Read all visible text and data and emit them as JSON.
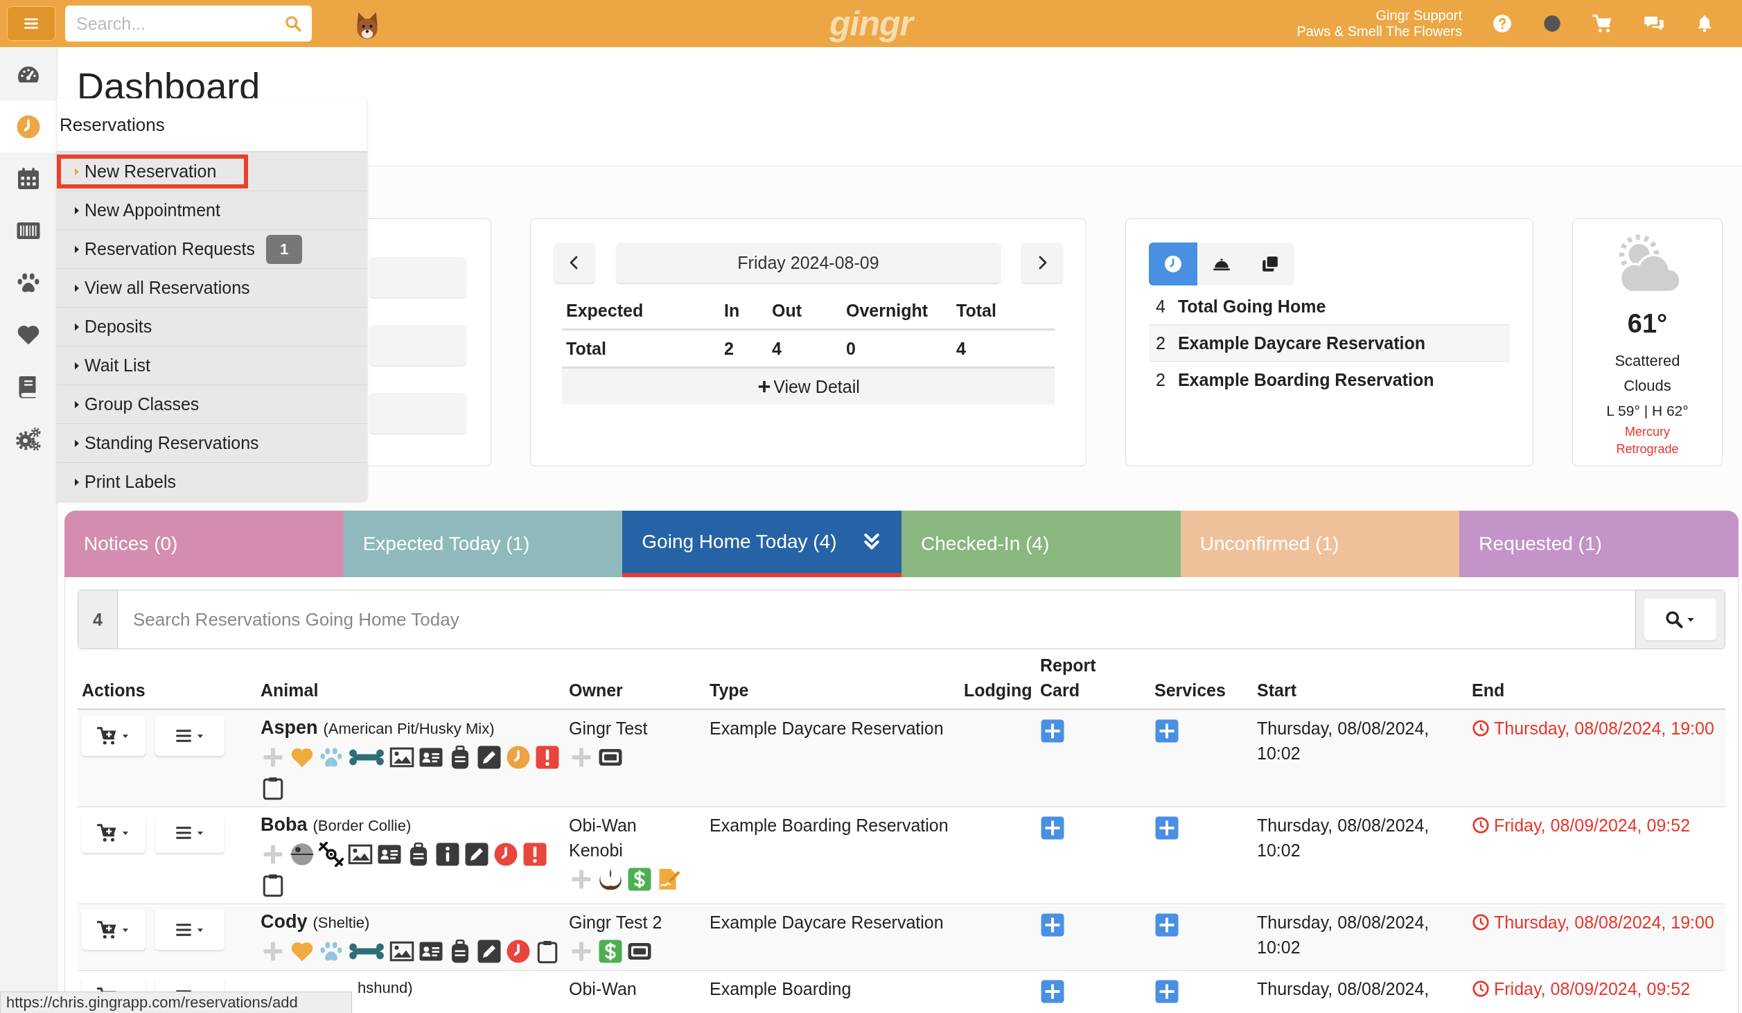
{
  "top_bar": {
    "search": {
      "placeholder": "Search..."
    },
    "logo": "gingr",
    "user": {
      "name": "Gingr Support",
      "business": "Paws & Smell The Flowers"
    }
  },
  "sidebar": {
    "items": [
      {
        "kind": "gauge",
        "selected": false
      },
      {
        "kind": "clock",
        "selected": true
      },
      {
        "kind": "calendar",
        "selected": false
      },
      {
        "kind": "barcode",
        "selected": false
      },
      {
        "kind": "paw",
        "selected": false
      },
      {
        "kind": "heart",
        "selected": false
      },
      {
        "kind": "book",
        "selected": false
      },
      {
        "kind": "gears",
        "selected": false
      }
    ]
  },
  "page_title": "Dashboard",
  "reservations_menu": {
    "title": "Reservations",
    "items": [
      {
        "label": "New Reservation",
        "selected": true
      },
      {
        "label": "New Appointment",
        "selected": false
      },
      {
        "label": "Reservation Requests",
        "selected": false,
        "badge": "1"
      },
      {
        "label": "View all Reservations",
        "selected": false
      },
      {
        "label": "Deposits",
        "selected": false
      },
      {
        "label": "Wait List",
        "selected": false
      },
      {
        "label": "Group Classes",
        "selected": false
      },
      {
        "label": "Standing Reservations",
        "selected": false
      },
      {
        "label": "Print Labels",
        "selected": false
      }
    ]
  },
  "date_card": {
    "date": "Friday 2024-08-09",
    "columns": [
      "Expected",
      "In",
      "Out",
      "Overnight",
      "Total"
    ],
    "row": [
      "Total",
      "2",
      "4",
      "0",
      "4"
    ],
    "link": "View Detail"
  },
  "summary_card": {
    "toggles": [
      {
        "kind": "clock",
        "selected": true
      },
      {
        "kind": "service-bell",
        "selected": false
      },
      {
        "kind": "copy",
        "selected": false
      }
    ],
    "rows": [
      {
        "count": "4",
        "label": "Total Going Home"
      },
      {
        "count": "2",
        "label": "Example Daycare Reservation"
      },
      {
        "count": "2",
        "label": "Example Boarding Reservation"
      }
    ]
  },
  "weather": {
    "temperature": "61°",
    "condition": "Scattered Clouds",
    "range": "L 59° | H 62°",
    "note": "Mercury Retrograde"
  },
  "tabs": [
    {
      "label": "Notices (0)",
      "color": "#d48db1",
      "selected": false
    },
    {
      "label": "Expected Today (1)",
      "color": "#8fb9bc",
      "selected": false
    },
    {
      "label": "Going Home Today (4)",
      "color": "#2563a6",
      "selected": true
    },
    {
      "label": "Checked-In (4)",
      "color": "#89b77f",
      "selected": false
    },
    {
      "label": "Unconfirmed (1)",
      "color": "#efc19b",
      "selected": false
    },
    {
      "label": "Requested (1)",
      "color": "#c493c8",
      "selected": false
    }
  ],
  "reservations": {
    "count": "4",
    "search": {
      "placeholder": "Search Reservations Going Home Today"
    },
    "columns": [
      "Actions",
      "Animal",
      "Owner",
      "Type",
      "Lodging",
      "Report Card",
      "Services",
      "Start",
      "End"
    ],
    "rows": [
      {
        "name": "Aspen",
        "breed": "(American Pit/Husky Mix)",
        "animal_icons": [
          {
            "kind": "plus"
          },
          {
            "kind": "heart"
          },
          {
            "kind": "paw"
          },
          {
            "kind": "bone"
          },
          {
            "kind": "image"
          },
          {
            "kind": "id-card"
          },
          {
            "kind": "backpack"
          },
          {
            "kind": "pencil"
          },
          {
            "kind": "clock",
            "color": "#eda142"
          },
          {
            "kind": "alert"
          },
          {
            "kind": "clipboard"
          }
        ],
        "owner": "Gingr Test",
        "owner_icons": [
          {
            "kind": "plus"
          },
          {
            "kind": "ticket"
          }
        ],
        "type": "Example Daycare Reservation",
        "start": "Thursday, 08/08/2024, 10:02",
        "end": "Thursday, 08/08/2024, 19:00"
      },
      {
        "name": "Boba",
        "breed": "(Border Collie)",
        "animal_icons": [
          {
            "kind": "plus"
          },
          {
            "kind": "sphere"
          },
          {
            "kind": "ship"
          },
          {
            "kind": "image"
          },
          {
            "kind": "id-card"
          },
          {
            "kind": "backpack"
          },
          {
            "kind": "info"
          },
          {
            "kind": "pencil"
          },
          {
            "kind": "clock",
            "color": "#e8453c"
          },
          {
            "kind": "alert"
          },
          {
            "kind": "clipboard"
          }
        ],
        "owner": "Obi-Wan Kenobi",
        "owner_icons": [
          {
            "kind": "plus"
          },
          {
            "kind": "emblem"
          },
          {
            "kind": "dollar"
          },
          {
            "kind": "signature"
          }
        ],
        "type": "Example Boarding Reservation",
        "start": "Thursday, 08/08/2024, 10:02",
        "end": "Friday, 08/09/2024, 09:52"
      },
      {
        "name": "Cody",
        "breed": "(Sheltie)",
        "animal_icons": [
          {
            "kind": "plus"
          },
          {
            "kind": "heart"
          },
          {
            "kind": "paw"
          },
          {
            "kind": "bone"
          },
          {
            "kind": "image"
          },
          {
            "kind": "id-card"
          },
          {
            "kind": "backpack"
          },
          {
            "kind": "pencil"
          },
          {
            "kind": "clock",
            "color": "#e8453c"
          },
          {
            "kind": "clipboard"
          }
        ],
        "owner": "Gingr Test 2",
        "owner_icons": [
          {
            "kind": "plus"
          },
          {
            "kind": "dollar"
          },
          {
            "kind": "ticket"
          }
        ],
        "type": "Example Daycare Reservation",
        "start": "Thursday, 08/08/2024, 10:02",
        "end": "Thursday, 08/08/2024, 19:00"
      },
      {
        "breed": "hshund)",
        "animal_icons": [],
        "owner": "Obi-Wan",
        "owner_icons": [],
        "type": "Example Boarding",
        "start": "Thursday, 08/08/2024,",
        "end": "Friday, 08/09/2024, 09:52"
      }
    ]
  },
  "status_bar": {
    "url": "https://chris.gingrapp.com/reservations/add"
  }
}
